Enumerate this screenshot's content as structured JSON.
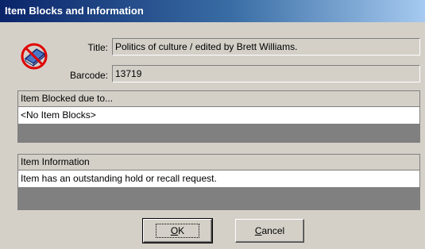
{
  "window": {
    "title": "Item Blocks and Information"
  },
  "icon": "item-blocked-icon",
  "form": {
    "title_label": "Title:",
    "title_value": "Politics of culture / edited by Brett Williams.",
    "barcode_label": "Barcode:",
    "barcode_value": "13719"
  },
  "blocks_panel": {
    "header": "Item Blocked due to...",
    "rows": [
      "<No Item Blocks>"
    ]
  },
  "info_panel": {
    "header": "Item Information",
    "rows": [
      "Item has an outstanding hold or recall request."
    ]
  },
  "buttons": {
    "ok_mnemonic": "O",
    "ok_rest": "K",
    "cancel_mnemonic": "C",
    "cancel_rest": "ancel"
  },
  "colors": {
    "titlebar_start": "#0a246a",
    "titlebar_end": "#a6caf0",
    "dialog_bg": "#d4d0c8"
  }
}
